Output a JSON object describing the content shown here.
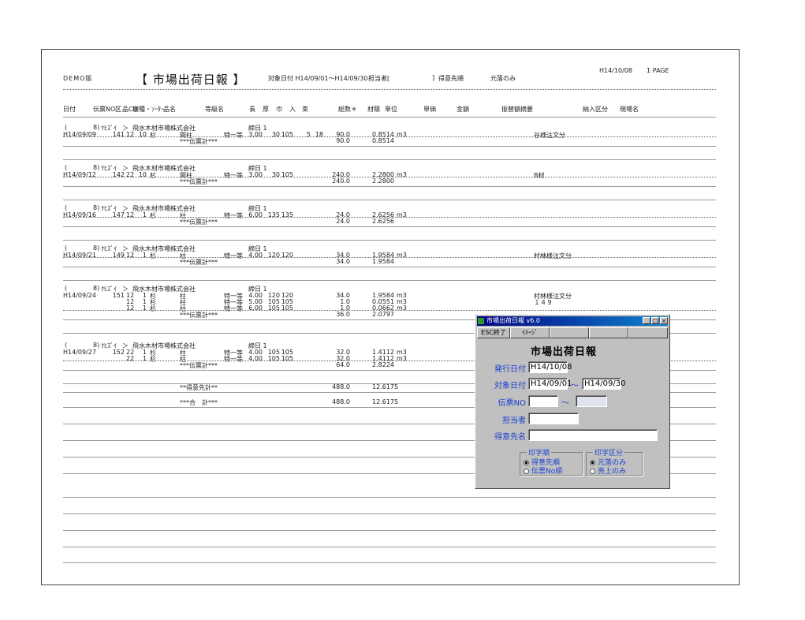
{
  "report": {
    "demo": "DEMO版",
    "title": "【 市場出荷日報 】",
    "target_date": "対象日付 H14/09/01～H14/09/30",
    "tanto": "担当者[",
    "bracket_close": "]",
    "order": "得意先順",
    "filter": "元落のみ",
    "issue_date": "H14/10/08",
    "page": "1 PAGE"
  },
  "columns": [
    "日付",
    "伝票NO",
    "区",
    "品CD",
    "樹種・ｿｰﾀｰ",
    "品名",
    "等級名",
    "長",
    "厚",
    "巾",
    "入",
    "束",
    "総数＊",
    "材積",
    "単位",
    "単価",
    "金額",
    "振替額",
    "摘要",
    "納入区分",
    "現場名"
  ],
  "groups": [
    {
      "header": {
        "paren": "(",
        "code": "8)",
        "kana": "ｸﾋｽﾞｲ",
        "arrow": "＞",
        "company": "飛水木材市場株式会社",
        "closing": "締日 1"
      },
      "rows": [
        {
          "date": "H14/09/09",
          "no": "141",
          "ku": "12",
          "cd": "10",
          "species": "杉",
          "item": "間柱",
          "grade": "特一等",
          "len": "3.00",
          "thick": "30",
          "width": "105",
          "ire": "5",
          "taba": "18",
          "total": "90.0",
          "volume": "0.8514",
          "unit": "m3",
          "memo": "谷様注文分"
        }
      ],
      "subtotal": {
        "label": "***伝票計***",
        "total": "90.0",
        "volume": "0.8514"
      }
    },
    {
      "header": {
        "paren": "(",
        "code": "8)",
        "kana": "ｸﾋｽﾞｲ",
        "arrow": "＞",
        "company": "飛水木材市場株式会社",
        "closing": "締日 1"
      },
      "rows": [
        {
          "date": "H14/09/12",
          "no": "142",
          "ku": "22",
          "cd": "10",
          "species": "杉",
          "item": "間柱",
          "grade": "特一等",
          "len": "3.00",
          "thick": "30",
          "width": "105",
          "ire": "",
          "taba": "",
          "total": "240.0",
          "volume": "2.2800",
          "unit": "m3",
          "memo": "B材"
        }
      ],
      "subtotal": {
        "label": "***伝票計***",
        "total": "240.0",
        "volume": "2.2800"
      }
    },
    {
      "header": {
        "paren": "(",
        "code": "8)",
        "kana": "ｸﾋｽﾞｲ",
        "arrow": "＞",
        "company": "飛水木材市場株式会社",
        "closing": "締日 1"
      },
      "rows": [
        {
          "date": "H14/09/16",
          "no": "147",
          "ku": "12",
          "cd": "1",
          "species": "杉",
          "item": "柱",
          "grade": "特一等",
          "len": "6.00",
          "thick": "135",
          "width": "135",
          "ire": "",
          "taba": "",
          "total": "24.0",
          "volume": "2.6256",
          "unit": "m3",
          "memo": ""
        }
      ],
      "subtotal": {
        "label": "***伝票計***",
        "total": "24.0",
        "volume": "2.6256"
      }
    },
    {
      "header": {
        "paren": "(",
        "code": "8)",
        "kana": "ｸﾋｽﾞｲ",
        "arrow": "＞",
        "company": "飛水木材市場株式会社",
        "closing": "締日 1"
      },
      "rows": [
        {
          "date": "H14/09/21",
          "no": "149",
          "ku": "12",
          "cd": "1",
          "species": "杉",
          "item": "柱",
          "grade": "特一等",
          "len": "4.00",
          "thick": "120",
          "width": "120",
          "ire": "",
          "taba": "",
          "total": "34.0",
          "volume": "1.9584",
          "unit": "m3",
          "memo": "村林様注文分"
        }
      ],
      "subtotal": {
        "label": "***伝票計***",
        "total": "34.0",
        "volume": "1.9584"
      }
    },
    {
      "header": {
        "paren": "(",
        "code": "8)",
        "kana": "ｸﾋｽﾞｲ",
        "arrow": "＞",
        "company": "飛水木材市場株式会社",
        "closing": "締日 1"
      },
      "rows": [
        {
          "date": "H14/09/24",
          "no": "151",
          "ku": "12",
          "cd": "1",
          "species": "杉",
          "item": "柱",
          "grade": "特一等",
          "len": "4.00",
          "thick": "120",
          "width": "120",
          "ire": "",
          "taba": "",
          "total": "34.0",
          "volume": "1.9584",
          "unit": "m3",
          "memo": "村林様注文分"
        },
        {
          "date": "",
          "no": "",
          "ku": "12",
          "cd": "1",
          "species": "杉",
          "item": "柱",
          "grade": "特一等",
          "len": "5.00",
          "thick": "105",
          "width": "105",
          "ire": "",
          "taba": "",
          "total": "1.0",
          "volume": "0.0551",
          "unit": "m3",
          "memo": "１４９"
        },
        {
          "date": "",
          "no": "",
          "ku": "12",
          "cd": "1",
          "species": "杉",
          "item": "柱",
          "grade": "特一等",
          "len": "6.00",
          "thick": "105",
          "width": "105",
          "ire": "",
          "taba": "",
          "total": "1.0",
          "volume": "0.0662",
          "unit": "m3",
          "memo": ""
        }
      ],
      "subtotal": {
        "label": "***伝票計***",
        "total": "36.0",
        "volume": "2.0797"
      }
    },
    {
      "header": {
        "paren": "(",
        "code": "8)",
        "kana": "ｸﾋｽﾞｲ",
        "arrow": "＞",
        "company": "飛水木材市場株式会社",
        "closing": "締日 1"
      },
      "rows": [
        {
          "date": "H14/09/27",
          "no": "152",
          "ku": "22",
          "cd": "1",
          "species": "杉",
          "item": "柱",
          "grade": "特一等",
          "len": "4.00",
          "thick": "105",
          "width": "105",
          "ire": "",
          "taba": "",
          "total": "32.0",
          "volume": "1.4112",
          "unit": "m3",
          "memo": ""
        },
        {
          "date": "",
          "no": "",
          "ku": "22",
          "cd": "1",
          "species": "杉",
          "item": "柱",
          "grade": "特一等",
          "len": "4.00",
          "thick": "105",
          "width": "105",
          "ire": "",
          "taba": "",
          "total": "32.0",
          "volume": "1.4112",
          "unit": "m3",
          "memo": ""
        }
      ],
      "subtotal": {
        "label": "***伝票計***",
        "total": "64.0",
        "volume": "2.8224"
      }
    }
  ],
  "customer_total": {
    "label": "**得意先計**",
    "total": "488.0",
    "volume": "12.6175"
  },
  "grand_total": {
    "label": "***合　計***",
    "total": "488.0",
    "volume": "12.6175"
  },
  "dialog": {
    "window_title": "市場出荷日報 v6.0",
    "esc_button": "ESC終了",
    "image_button": "ｲﾒｰｼﾞ",
    "heading": "市場出荷日報",
    "issue_label": "発行日付",
    "issue_value": "H14/10/08",
    "target_label": "対象日付",
    "target_from": "H14/09/01",
    "tilde": "～",
    "target_to": "H14/09/30",
    "slip_label": "伝票NO",
    "slip_from": "",
    "slip_to": "",
    "tanto_label": "担当者",
    "tanto_value": "",
    "customer_label": "得意先名",
    "customer_value": "",
    "print_order": {
      "title": "印字順",
      "options": [
        "得意先順",
        "伝票No順"
      ],
      "selected": "得意先順"
    },
    "print_kind": {
      "title": "印字区分",
      "options": [
        "元落のみ",
        "売上のみ"
      ],
      "selected": "元落のみ"
    },
    "minimize": "_",
    "maximize": "□",
    "close": "×"
  }
}
